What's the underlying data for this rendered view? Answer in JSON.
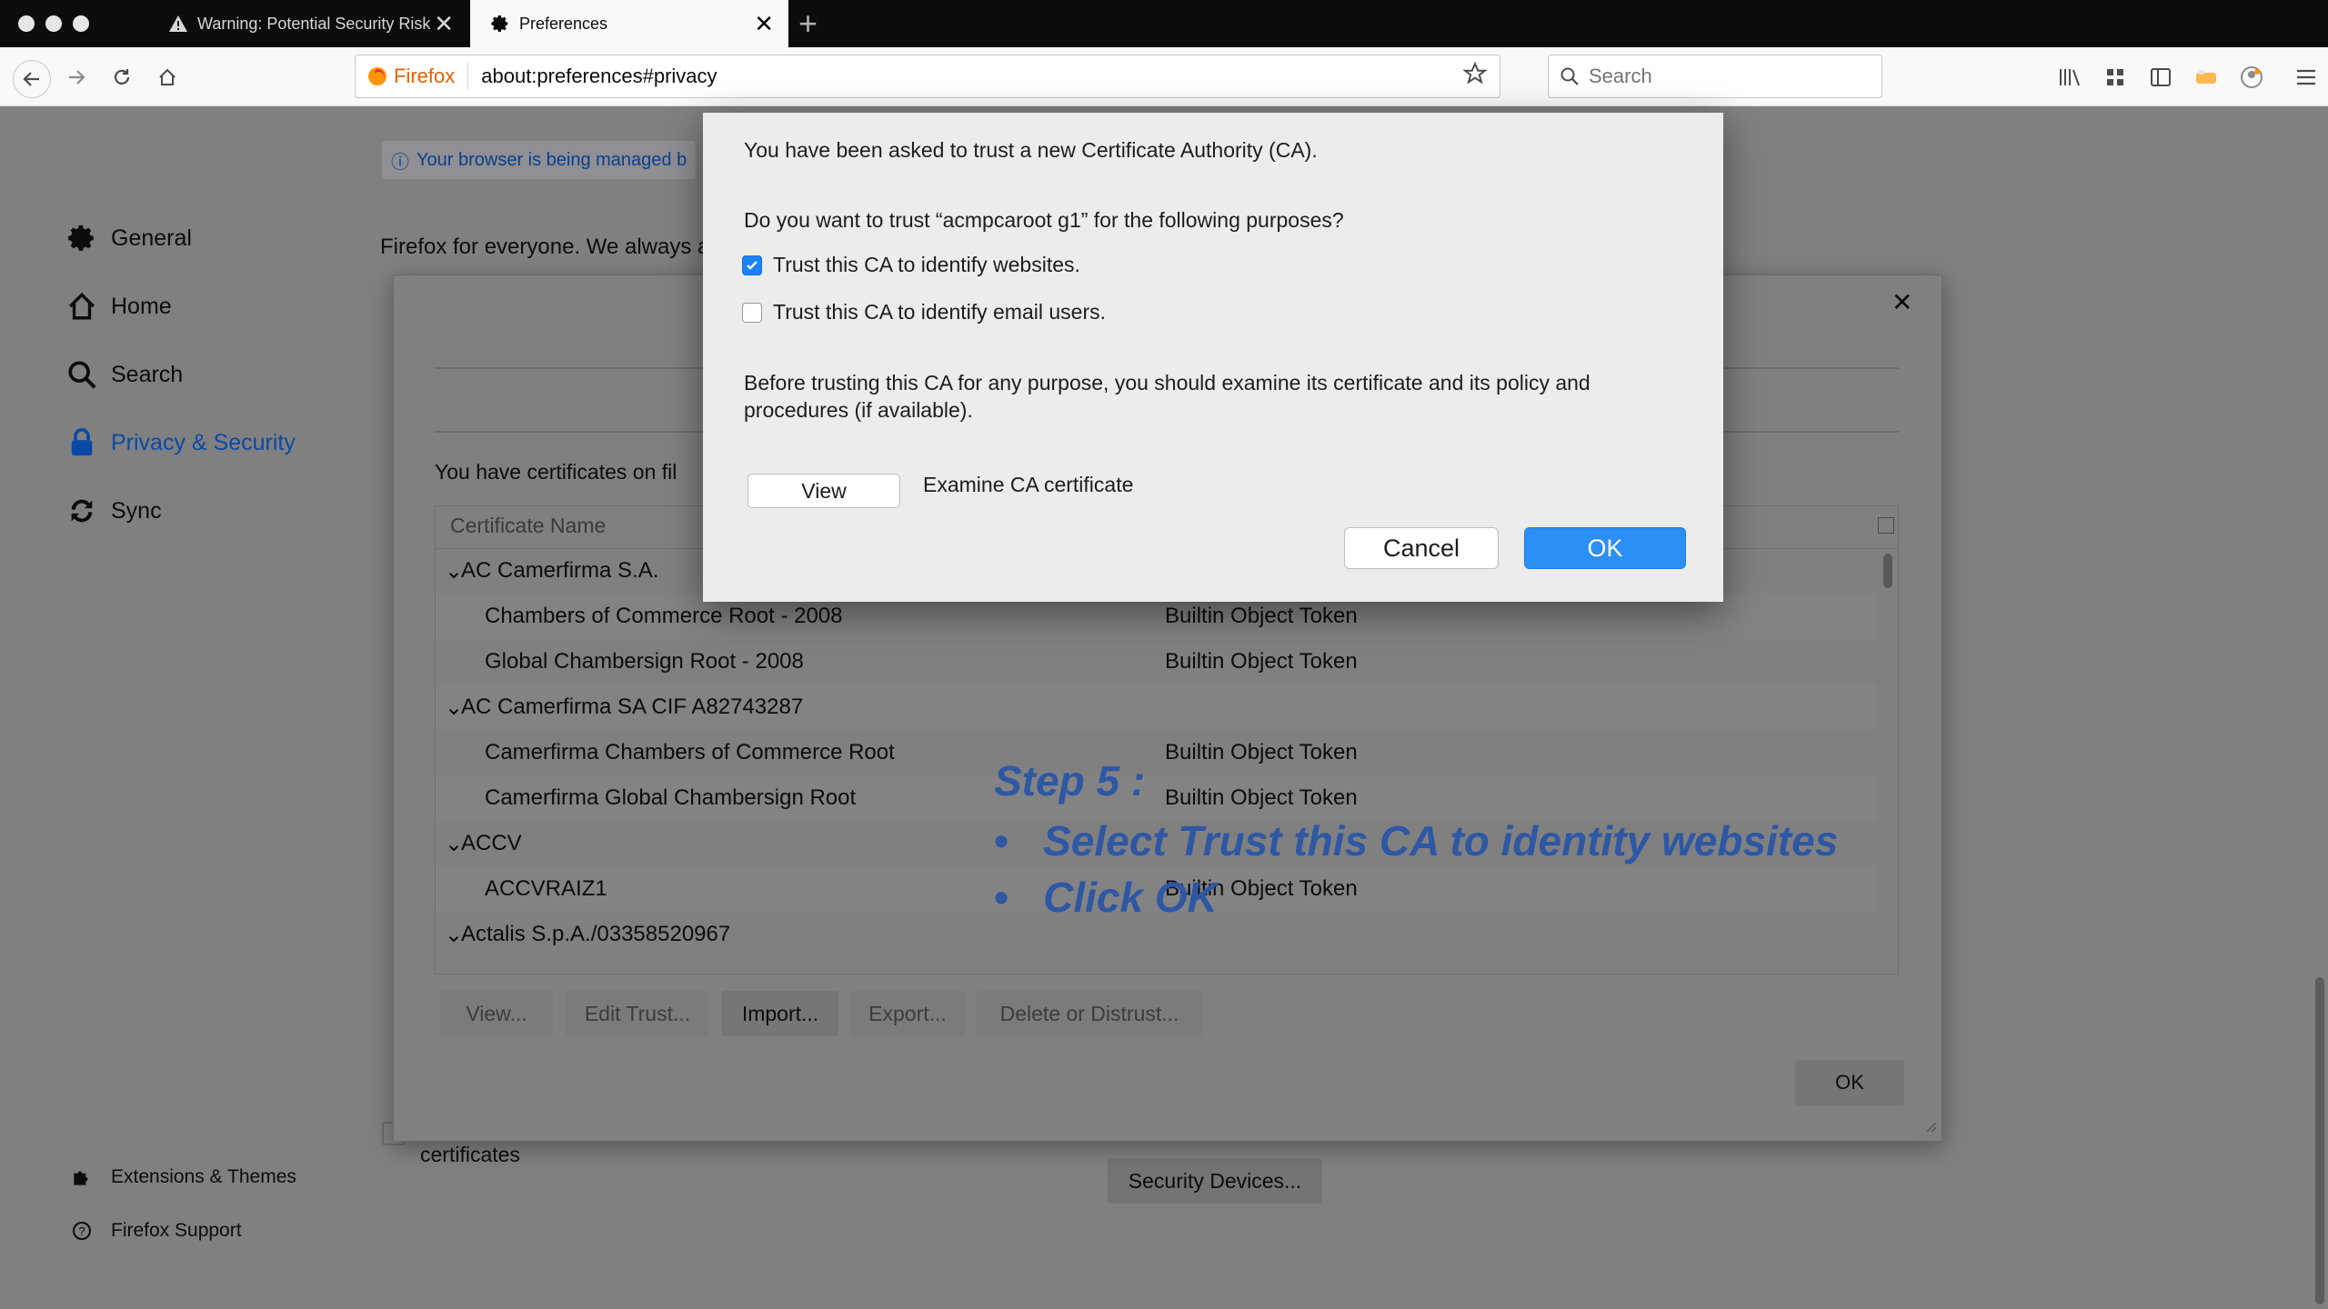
{
  "browser": {
    "tabs": [
      {
        "label": "Warning: Potential Security Risk",
        "icon": "warning-icon"
      },
      {
        "label": "Preferences",
        "icon": "gear-icon"
      }
    ],
    "brand": "Firefox",
    "url": "about:preferences#privacy",
    "search_placeholder": "Search"
  },
  "sidebar": {
    "items": [
      {
        "label": "General",
        "icon": "gear-icon"
      },
      {
        "label": "Home",
        "icon": "home-icon"
      },
      {
        "label": "Search",
        "icon": "search-icon"
      },
      {
        "label": "Privacy & Security",
        "icon": "lock-icon",
        "active": true
      },
      {
        "label": "Sync",
        "icon": "sync-icon"
      }
    ],
    "footer": [
      {
        "label": "Extensions & Themes",
        "icon": "puzzle-icon"
      },
      {
        "label": "Firefox Support",
        "icon": "help-icon"
      }
    ]
  },
  "page": {
    "managed_notice": "Your browser is being managed b",
    "intro_text": "Firefox for everyone. We always a",
    "certificates_label": "certificates",
    "security_devices_button": "Security Devices..."
  },
  "cert_manager": {
    "message": "You have certificates on fil",
    "column_header": "Certificate Name",
    "rows": [
      {
        "name": "AC Camerfirma S.A.",
        "group": true,
        "token": ""
      },
      {
        "name": "Chambers of Commerce Root - 2008",
        "group": false,
        "token": "Builtin Object Token"
      },
      {
        "name": "Global Chambersign Root - 2008",
        "group": false,
        "token": "Builtin Object Token"
      },
      {
        "name": "AC Camerfirma SA CIF A82743287",
        "group": true,
        "token": ""
      },
      {
        "name": "Camerfirma Chambers of Commerce Root",
        "group": false,
        "token": "Builtin Object Token"
      },
      {
        "name": "Camerfirma Global Chambersign Root",
        "group": false,
        "token": "Builtin Object Token"
      },
      {
        "name": "ACCV",
        "group": true,
        "token": ""
      },
      {
        "name": "ACCVRAIZ1",
        "group": false,
        "token": "Builtin Object Token"
      },
      {
        "name": "Actalis S.p.A./03358520967",
        "group": true,
        "token": ""
      }
    ],
    "buttons": {
      "view": "View...",
      "edit_trust": "Edit Trust...",
      "import": "Import...",
      "export": "Export...",
      "delete": "Delete or Distrust...",
      "ok": "OK"
    }
  },
  "trust_dialog": {
    "line1": "You have been asked to trust a new Certificate Authority (CA).",
    "question": "Do you want to trust “acmpcaroot g1” for the following purposes?",
    "checkbox_websites": {
      "label": "Trust this CA to identify websites.",
      "checked": true
    },
    "checkbox_email": {
      "label": "Trust this CA to identify email users.",
      "checked": false
    },
    "advice": "Before trusting this CA for any purpose, you should examine its certificate and its policy and procedures (if available).",
    "view_button": "View",
    "view_caption": "Examine CA certificate",
    "cancel_button": "Cancel",
    "ok_button": "OK"
  },
  "annotation": {
    "title": "Step 5 :",
    "bullets": [
      "Select Trust this CA to identity websites",
      "Click OK"
    ],
    "color": "#2e57a4"
  }
}
